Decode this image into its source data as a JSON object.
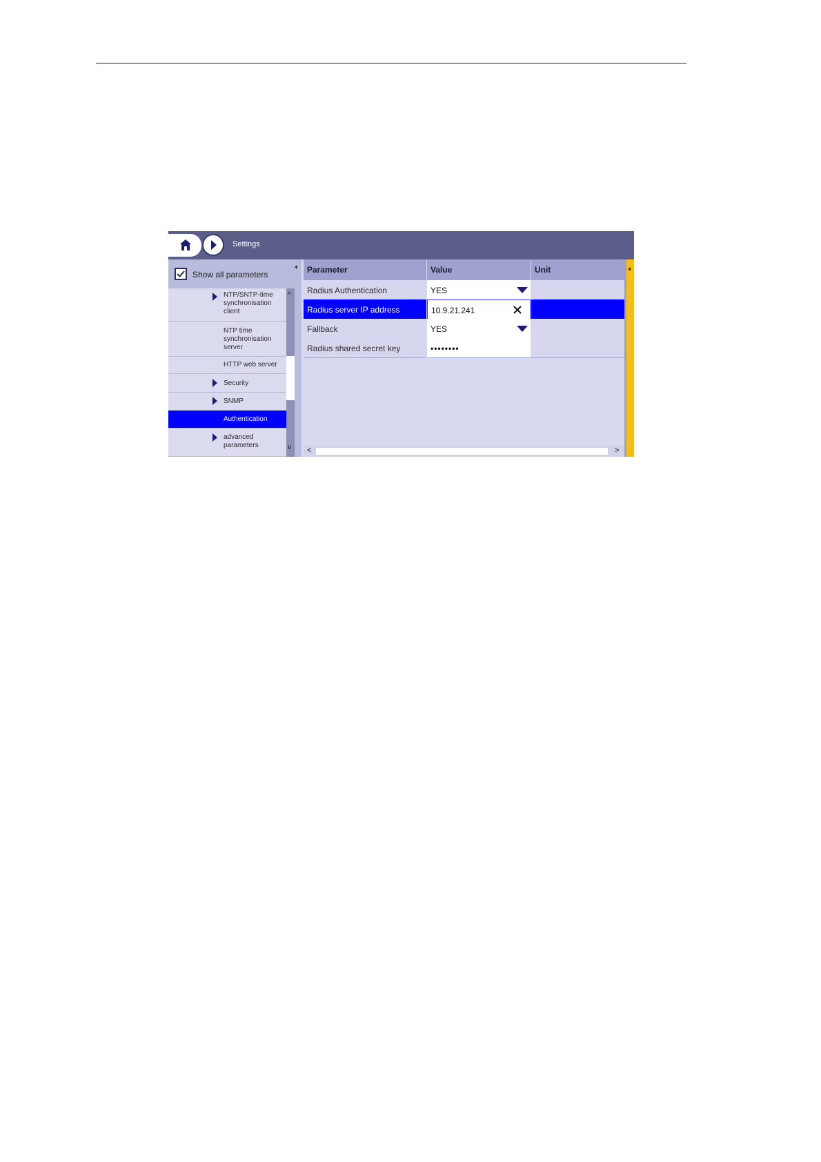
{
  "header": {
    "title": "Settings"
  },
  "left_panel": {
    "show_all_label": "Show all parameters",
    "show_all_checked": true,
    "tree_items": [
      {
        "label": "NTP/SNTP-time\nsynchronisation\nclient",
        "has_children": true
      },
      {
        "label": "NTP time\nsynchronisation\nserver",
        "has_children": false
      },
      {
        "label": "HTTP web server",
        "has_children": false
      },
      {
        "label": "Security",
        "has_children": true
      },
      {
        "label": "SNMP",
        "has_children": true
      },
      {
        "label": "Authentication",
        "has_children": false,
        "selected": true
      },
      {
        "label": "advanced\nparameters",
        "has_children": true
      }
    ]
  },
  "table": {
    "headers": {
      "parameter": "Parameter",
      "value": "Value",
      "unit": "Unit"
    },
    "rows": [
      {
        "parameter": "Radius Authentication",
        "value": "YES",
        "unit": "",
        "control": "dropdown"
      },
      {
        "parameter": "Radius server IP address",
        "value": "10.9.21.241",
        "unit": "",
        "control": "text-clear",
        "selected": true
      },
      {
        "parameter": "Fallback",
        "value": "YES",
        "unit": "",
        "control": "dropdown"
      },
      {
        "parameter": "Radius shared secret key",
        "value": "••••••••",
        "unit": "",
        "control": "password"
      }
    ]
  },
  "colors": {
    "header_bar": "#5c5e8a",
    "selection": "#0000ff",
    "accent_bar": "#f2bd1d",
    "panel_bg": "#d8d9ee"
  }
}
